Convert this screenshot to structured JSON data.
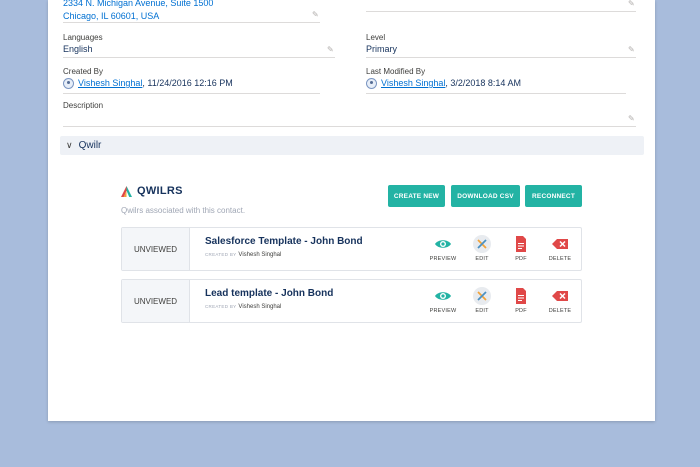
{
  "address": {
    "line1": "2334 N. Michigan Avenue, Suite 1500",
    "line2": "Chicago, IL 60601, USA"
  },
  "languages": {
    "label": "Languages",
    "value": "English"
  },
  "level": {
    "label": "Level",
    "value": "Primary"
  },
  "created_by": {
    "label": "Created By",
    "user": "Vishesh Singhal",
    "timestamp": ", 11/24/2016 12:16 PM"
  },
  "last_modified_by": {
    "label": "Last Modified By",
    "user": "Vishesh Singhal",
    "timestamp": ", 3/2/2018 8:14 AM"
  },
  "description": {
    "label": "Description",
    "value": ""
  },
  "section": {
    "title": "Qwilr"
  },
  "qwilr": {
    "title": "QWILRS",
    "subtitle": "Qwilrs associated with this contact.",
    "buttons": {
      "create": "CREATE NEW",
      "download": "DOWNLOAD CSV",
      "reconnect": "RECONNECT"
    },
    "created_by_caption": "CREATED BY",
    "actions": {
      "preview": "PREVIEW",
      "edit": "EDIT",
      "pdf": "PDF",
      "delete": "DELETE"
    },
    "colors": {
      "accent": "#23b3a4",
      "pdf": "#e04848",
      "delete": "#e04848"
    },
    "rows": [
      {
        "status": "UNVIEWED",
        "name": "Salesforce Template - John Bond",
        "creator": "Vishesh Singhal"
      },
      {
        "status": "UNVIEWED",
        "name": "Lead template - John Bond",
        "creator": "Vishesh Singhal"
      }
    ]
  }
}
